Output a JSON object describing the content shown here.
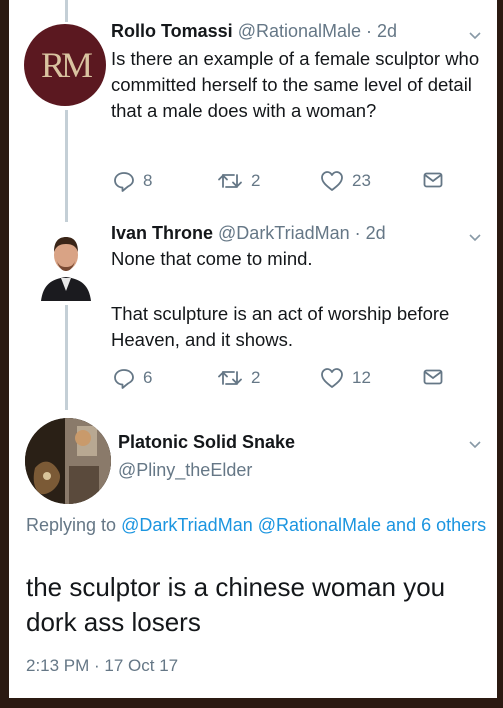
{
  "tweets": [
    {
      "avatar_initials": "RM",
      "name": "Rollo Tomassi",
      "handle_time": "@RationalMale · 2d",
      "text": "Is there an example of a female sculptor who committed herself to the same level of detail that a male does with a woman?",
      "replies": "8",
      "retweets": "2",
      "likes": "23"
    },
    {
      "name": "Ivan Throne",
      "handle_time": "@DarkTriadMan · 2d",
      "text_line1": "None that come to mind.",
      "text_line2": "That sculpture is an act of worship before Heaven, and it shows.",
      "replies": "6",
      "retweets": "2",
      "likes": "12"
    }
  ],
  "main_tweet": {
    "name": "Platonic Solid Snake",
    "handle": "@Pliny_theElder",
    "replying_prefix": "Replying to",
    "replying_links": "@DarkTriadMan @RationalMale and 6 others",
    "text": "the sculptor is a chinese woman you dork ass losers",
    "timestamp": "2:13 PM · 17 Oct 17"
  },
  "icons": {
    "reply": "reply-icon",
    "retweet": "retweet-icon",
    "like": "heart-icon",
    "dm": "mail-icon",
    "menu": "chevron-down-icon"
  },
  "colors": {
    "link": "#1b95e0",
    "secondary_text": "#657786",
    "thread_line": "#c4cfd6",
    "background_border": "#2b1a12"
  }
}
